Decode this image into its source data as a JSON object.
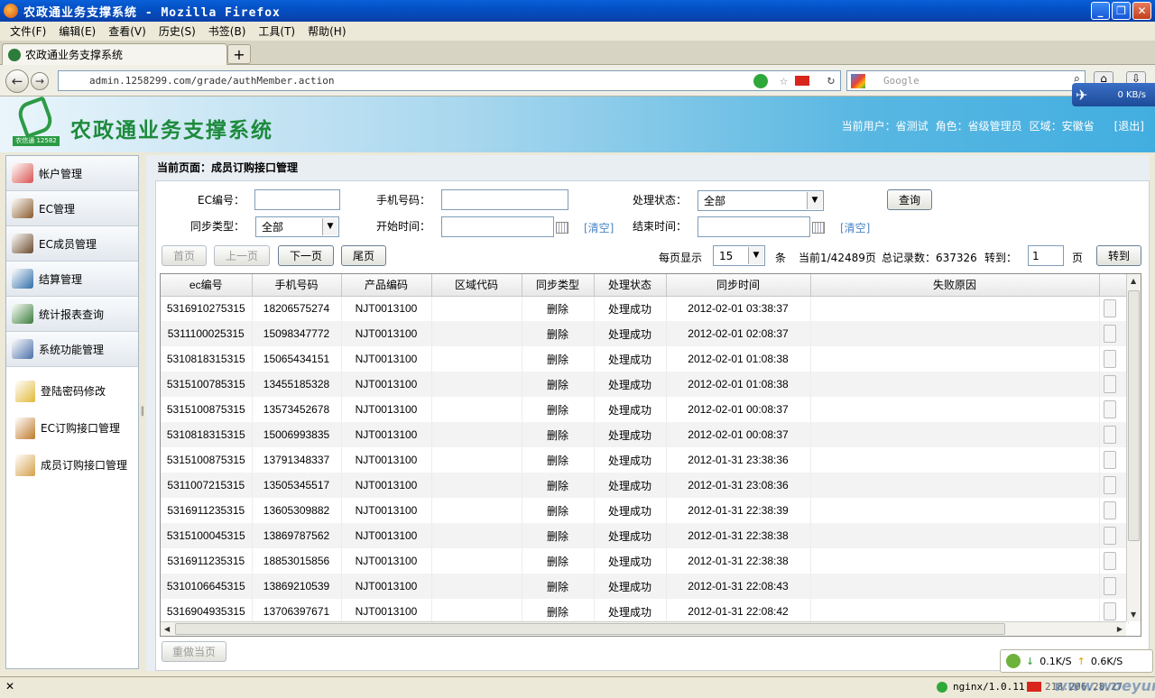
{
  "browser": {
    "window_title": "农政通业务支撑系统 - Mozilla Firefox",
    "menu": [
      "文件(F)",
      "编辑(E)",
      "查看(V)",
      "历史(S)",
      "书签(B)",
      "工具(T)",
      "帮助(H)"
    ],
    "tab_title": "农政通业务支撑系统",
    "url": "admin.1258299.com/grade/authMember.action",
    "search_placeholder": "Google",
    "speed": "0 KB/s",
    "net_down": "0.1K/S",
    "net_up": "0.6K/S",
    "status_server": "nginx/1.0.11",
    "status_ip": "218.206.28.27",
    "watermark": "www.woeyun.com"
  },
  "app": {
    "title": "农政通业务支撑系统",
    "logo_tag": "农信通 12582",
    "user_label": "当前用户：省测试",
    "role_label": "角色：省级管理员",
    "region_label": "区域：安徽省",
    "logout": "[退出]"
  },
  "sidebar": {
    "items": [
      {
        "label": "帐户管理",
        "color": "#d9534f"
      },
      {
        "label": "EC管理",
        "color": "#8a5a2b"
      },
      {
        "label": "EC成员管理",
        "color": "#6b4a2b"
      },
      {
        "label": "结算管理",
        "color": "#2f6ea8"
      },
      {
        "label": "统计报表查询",
        "color": "#3a7d3a"
      },
      {
        "label": "系统功能管理",
        "color": "#4a6fa8"
      }
    ],
    "subitems": [
      {
        "label": "登陆密码修改",
        "color": "#e2b93b"
      },
      {
        "label": "EC订购接口管理",
        "color": "#c07a2c"
      },
      {
        "label": "成员订购接口管理",
        "color": "#d4a04a"
      }
    ]
  },
  "page": {
    "breadcrumb": "当前页面：成员订购接口管理",
    "form": {
      "ec_label": "EC编号：",
      "ec_value": "",
      "phone_label": "手机号码：",
      "phone_value": "",
      "status_label": "处理状态：",
      "status_value": "全部",
      "query_button": "查询",
      "sync_label": "同步类型：",
      "sync_value": "全部",
      "start_label": "开始时间：",
      "start_value": "",
      "end_label": "结束时间：",
      "end_value": "",
      "clear_label": "[清空]"
    },
    "pager": {
      "first": "首页",
      "prev": "上一页",
      "next": "下一页",
      "last": "尾页",
      "per_page_label": "每页显示",
      "per_page_value": "15",
      "unit": "条",
      "current": "当前1/42489页",
      "total": "总记录数：637326",
      "goto_label": "转到：",
      "goto_value": "1",
      "page_unit": "页",
      "goto_button": "转到"
    },
    "table": {
      "headers": [
        "ec编号",
        "手机号码",
        "产品编码",
        "区域代码",
        "同步类型",
        "处理状态",
        "同步时间",
        "失败原因"
      ],
      "rows": [
        [
          "5316910275315",
          "18206575274",
          "NJT0013100",
          "",
          "删除",
          "处理成功",
          "2012-02-01 03:38:37",
          ""
        ],
        [
          "5311100025315",
          "15098347772",
          "NJT0013100",
          "",
          "删除",
          "处理成功",
          "2012-02-01 02:08:37",
          ""
        ],
        [
          "5310818315315",
          "15065434151",
          "NJT0013100",
          "",
          "删除",
          "处理成功",
          "2012-02-01 01:08:38",
          ""
        ],
        [
          "5315100785315",
          "13455185328",
          "NJT0013100",
          "",
          "删除",
          "处理成功",
          "2012-02-01 01:08:38",
          ""
        ],
        [
          "5315100875315",
          "13573452678",
          "NJT0013100",
          "",
          "删除",
          "处理成功",
          "2012-02-01 00:08:37",
          ""
        ],
        [
          "5310818315315",
          "15006993835",
          "NJT0013100",
          "",
          "删除",
          "处理成功",
          "2012-02-01 00:08:37",
          ""
        ],
        [
          "5315100875315",
          "13791348337",
          "NJT0013100",
          "",
          "删除",
          "处理成功",
          "2012-01-31 23:38:36",
          ""
        ],
        [
          "5311007215315",
          "13505345517",
          "NJT0013100",
          "",
          "删除",
          "处理成功",
          "2012-01-31 23:08:36",
          ""
        ],
        [
          "5316911235315",
          "13605309882",
          "NJT0013100",
          "",
          "删除",
          "处理成功",
          "2012-01-31 22:38:39",
          ""
        ],
        [
          "5315100045315",
          "13869787562",
          "NJT0013100",
          "",
          "删除",
          "处理成功",
          "2012-01-31 22:38:38",
          ""
        ],
        [
          "5316911235315",
          "18853015856",
          "NJT0013100",
          "",
          "删除",
          "处理成功",
          "2012-01-31 22:38:38",
          ""
        ],
        [
          "5310106645315",
          "13869210539",
          "NJT0013100",
          "",
          "删除",
          "处理成功",
          "2012-01-31 22:08:43",
          ""
        ],
        [
          "5316904935315",
          "13706397671",
          "NJT0013100",
          "",
          "删除",
          "处理成功",
          "2012-01-31 22:08:42",
          ""
        ]
      ]
    },
    "redo_button": "重做当页"
  }
}
